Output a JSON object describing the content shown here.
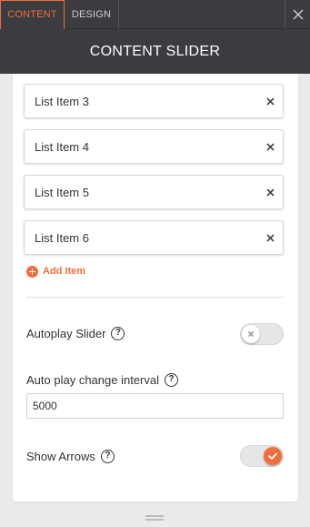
{
  "tabs": {
    "content_label": "CONTENT",
    "design_label": "DESIGN"
  },
  "header": {
    "title": "CONTENT SLIDER"
  },
  "list_items": [
    {
      "label": "List Item 3"
    },
    {
      "label": "List Item 4"
    },
    {
      "label": "List Item 5"
    },
    {
      "label": "List Item 6"
    }
  ],
  "add_item": {
    "label": "Add Item"
  },
  "autoplay": {
    "label": "Autoplay Slider",
    "help": "?",
    "enabled": false
  },
  "interval": {
    "label": "Auto play change interval",
    "help": "?",
    "value": "5000"
  },
  "arrows": {
    "label": "Show Arrows",
    "help": "?",
    "enabled": true
  },
  "colors": {
    "accent": "#f26d3d",
    "header_bg": "#3a3c3f",
    "page_bg": "#e9ebec"
  },
  "icons": {
    "close": "close-icon",
    "remove": "remove-icon",
    "drag": "drag-handle-icon",
    "add": "plus-circle-icon",
    "help": "help-icon",
    "check": "check-icon",
    "resize": "resize-handle-icon"
  }
}
